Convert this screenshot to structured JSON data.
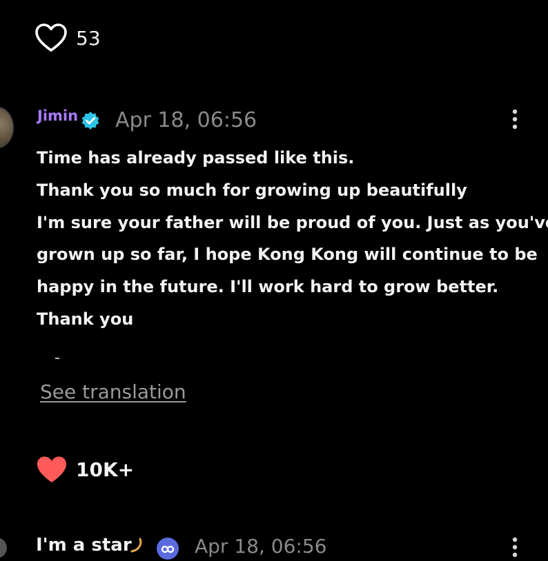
{
  "post": {
    "like_count": "53",
    "like_icon": "heart-outline-icon"
  },
  "comment": {
    "author": "Jimin",
    "verified_icon": "verified-badge-icon",
    "timestamp": "Apr 18, 06:56",
    "more_icon": "more-vertical-icon",
    "lines": [
      "Time has already passed like this.",
      "Thank you so much for growing up beautifully",
      "I'm sure your father will be proud of you. Just as you've",
      "grown up so far, I hope Kong Kong will continue to be",
      "happy in the future. I'll work hard to grow better.",
      "Thank you"
    ],
    "see_translation": "See translation",
    "reaction_icon": "heart-filled-icon",
    "reaction_count": "10K+"
  },
  "next_comment": {
    "author": "I'm a star",
    "timestamp": "Apr 18, 06:56"
  },
  "colors": {
    "background": "#000000",
    "author": "#a97bff",
    "verified": "#2ec4e6",
    "timestamp": "#8a8a8a",
    "link": "#9a9a9a",
    "heart": "#ff5a5a"
  }
}
